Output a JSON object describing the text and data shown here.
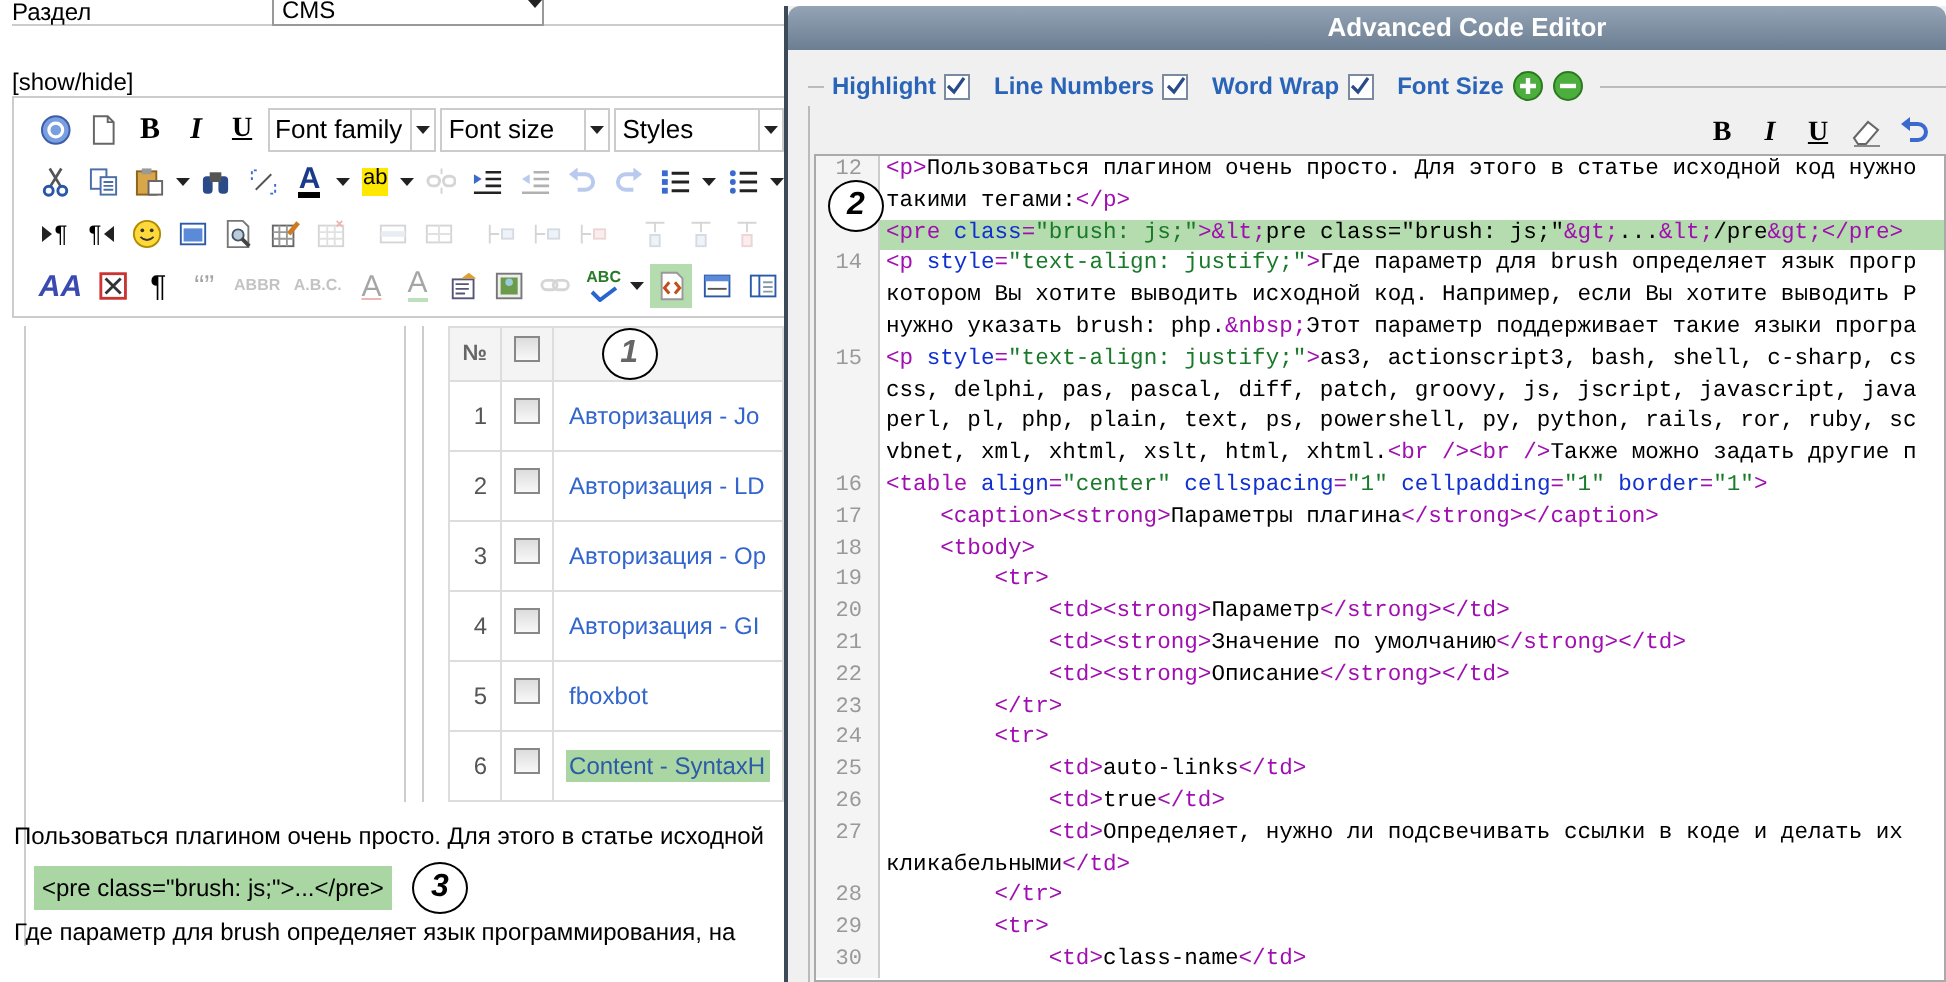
{
  "section_field": {
    "label": "Раздел",
    "value": "CMS"
  },
  "show_hide": "[show/hide]",
  "toolbar_rows": [
    [
      {
        "kind": "help",
        "disabled": false
      },
      {
        "kind": "document",
        "disabled": false
      },
      {
        "kind": "bold",
        "text": "B",
        "disabled": false
      },
      {
        "kind": "italic",
        "text": "I",
        "disabled": false
      },
      {
        "kind": "underline",
        "text": "U",
        "disabled": false
      },
      {
        "kind": "select",
        "text": "Font family"
      },
      {
        "kind": "select",
        "text": "Font size"
      },
      {
        "kind": "select",
        "text": "Styles"
      }
    ],
    [
      {
        "kind": "cut",
        "disabled": false
      },
      {
        "kind": "copy",
        "disabled": false
      },
      {
        "kind": "paste",
        "disabled": false,
        "dropdown": true
      },
      {
        "kind": "find",
        "disabled": false
      },
      {
        "kind": "replace",
        "disabled": false
      },
      {
        "kind": "forecolor",
        "text": "A",
        "disabled": false,
        "dropdown": true
      },
      {
        "kind": "backcolor",
        "text": "ab",
        "disabled": false,
        "dropdown": true
      },
      {
        "kind": "unlink",
        "disabled": true
      },
      {
        "kind": "indent",
        "disabled": false
      },
      {
        "kind": "outdent",
        "disabled": true
      },
      {
        "kind": "undo",
        "disabled": true
      },
      {
        "kind": "redo",
        "disabled": true
      },
      {
        "kind": "numlist",
        "disabled": false,
        "dropdown": true
      },
      {
        "kind": "bullist",
        "disabled": false,
        "dropdown": true
      }
    ],
    [
      {
        "kind": "ltr",
        "text": "¶",
        "disabled": false
      },
      {
        "kind": "rtl",
        "text": "¶",
        "disabled": false
      },
      {
        "kind": "smiley",
        "disabled": false
      },
      {
        "kind": "window",
        "disabled": false
      },
      {
        "kind": "preview",
        "disabled": false
      },
      {
        "kind": "table-edit",
        "disabled": false
      },
      {
        "kind": "table-delete",
        "disabled": true
      },
      {
        "kind": "sep"
      },
      {
        "kind": "table-row",
        "disabled": true
      },
      {
        "kind": "table-cell",
        "disabled": true
      },
      {
        "kind": "sep"
      },
      {
        "kind": "row-insert",
        "disabled": true
      },
      {
        "kind": "row-insert",
        "disabled": true
      },
      {
        "kind": "row-delete",
        "disabled": true
      },
      {
        "kind": "sep"
      },
      {
        "kind": "col-insert",
        "disabled": true
      },
      {
        "kind": "col-insert",
        "disabled": true
      },
      {
        "kind": "col-delete",
        "disabled": true
      },
      {
        "kind": "sep"
      }
    ],
    [
      {
        "kind": "styleprops",
        "text": "AA",
        "disabled": false
      },
      {
        "kind": "cross-box",
        "disabled": false
      },
      {
        "kind": "pilcrow",
        "text": "¶",
        "disabled": false
      },
      {
        "kind": "cite",
        "text": "“”",
        "disabled": true
      },
      {
        "kind": "abbr",
        "text": "ABBR",
        "disabled": true
      },
      {
        "kind": "acronym",
        "text": "A.B.C.",
        "disabled": true
      },
      {
        "kind": "strike",
        "text": "A",
        "disabled": true
      },
      {
        "kind": "attribs",
        "text": "A",
        "disabled": true
      },
      {
        "kind": "template",
        "disabled": false
      },
      {
        "kind": "picture",
        "disabled": false
      },
      {
        "kind": "link",
        "disabled": true
      },
      {
        "kind": "spell",
        "text": "ABC",
        "disabled": false,
        "dropdown": true
      },
      {
        "kind": "code",
        "disabled": false,
        "selected": true
      },
      {
        "kind": "hr",
        "disabled": false
      },
      {
        "kind": "columns",
        "disabled": false
      }
    ]
  ],
  "table": {
    "number_heading": "№",
    "header_checked": false,
    "callout": "1",
    "rows": [
      {
        "number": "1",
        "checked": false,
        "title": "Авторизация - Jo",
        "selected": false
      },
      {
        "number": "2",
        "checked": false,
        "title": "Авторизация - LD",
        "selected": false
      },
      {
        "number": "3",
        "checked": false,
        "title": "Авторизация - Op",
        "selected": false
      },
      {
        "number": "4",
        "checked": false,
        "title": "Авторизация - GI",
        "selected": false
      },
      {
        "number": "5",
        "checked": false,
        "title": "fboxbot",
        "selected": false
      },
      {
        "number": "6",
        "checked": false,
        "title": "Content - SyntaxH",
        "selected": true
      }
    ]
  },
  "content": {
    "paragraph": "Пользоваться плагином очень просто. Для этого в статье исходной",
    "snippet": "<pre class=\"brush: js;\">...</pre>",
    "callout": "3",
    "paragraph_2": "Где параметр для brush определяет язык программирования, на"
  },
  "editor": {
    "title": "Advanced Code Editor",
    "options": [
      {
        "label": "Highlight",
        "checked": true
      },
      {
        "label": "Line Numbers",
        "checked": true
      },
      {
        "label": "Word Wrap",
        "checked": true
      }
    ],
    "font_size": "Font Size",
    "format_buttons": [
      {
        "kind": "bold",
        "text": "B"
      },
      {
        "kind": "italic",
        "text": "I"
      },
      {
        "kind": "underline",
        "text": "U"
      },
      {
        "kind": "eraser"
      },
      {
        "kind": "undo"
      }
    ],
    "callout": "2",
    "lines": [
      {
        "number": "12",
        "selected": false,
        "tokens": [
          {
            "kind": "tag",
            "text": "<p>"
          },
          {
            "kind": "text",
            "text": "Пользоваться плагином очень просто. Для этого в статье исходной код нужно"
          }
        ]
      },
      {
        "selected": false,
        "tokens": [
          {
            "kind": "text",
            "text": "такими тегами:"
          },
          {
            "kind": "tag",
            "text": "</p>"
          }
        ]
      },
      {
        "selected": true,
        "tokens": [
          {
            "kind": "tag",
            "text": "<pre "
          },
          {
            "kind": "attr",
            "text": "class"
          },
          {
            "kind": "tag",
            "text": "="
          },
          {
            "kind": "value",
            "text": "\"brush: js;\""
          },
          {
            "kind": "tag",
            "text": ">"
          },
          {
            "kind": "entity",
            "text": "&lt;"
          },
          {
            "kind": "text",
            "text": "pre class=\"brush: js;\""
          },
          {
            "kind": "entity",
            "text": "&gt;"
          },
          {
            "kind": "text",
            "text": "..."
          },
          {
            "kind": "entity",
            "text": "&lt;"
          },
          {
            "kind": "text",
            "text": "/pre"
          },
          {
            "kind": "entity",
            "text": "&gt;"
          },
          {
            "kind": "tag",
            "text": "</pre>"
          }
        ]
      },
      {
        "number": "14",
        "selected": false,
        "tokens": [
          {
            "kind": "tag",
            "text": "<p "
          },
          {
            "kind": "attr",
            "text": "style"
          },
          {
            "kind": "tag",
            "text": "="
          },
          {
            "kind": "value",
            "text": "\"text-align: justify;\""
          },
          {
            "kind": "tag",
            "text": ">"
          },
          {
            "kind": "text",
            "text": "Где параметр для brush определяет язык прогр"
          }
        ]
      },
      {
        "selected": false,
        "tokens": [
          {
            "kind": "text",
            "text": "котором Вы хотите выводить исходной код. Например, если Вы хотите выводить P"
          }
        ]
      },
      {
        "selected": false,
        "tokens": [
          {
            "kind": "text",
            "text": "нужно указать brush: php."
          },
          {
            "kind": "entity",
            "text": "&nbsp;"
          },
          {
            "kind": "text",
            "text": "Этот параметр поддерживает такие языки програ"
          }
        ]
      },
      {
        "number": "15",
        "selected": false,
        "tokens": [
          {
            "kind": "tag",
            "text": "<p "
          },
          {
            "kind": "attr",
            "text": "style"
          },
          {
            "kind": "tag",
            "text": "="
          },
          {
            "kind": "value",
            "text": "\"text-align: justify;\""
          },
          {
            "kind": "tag",
            "text": ">"
          },
          {
            "kind": "text",
            "text": "as3, actionscript3, bash, shell, c-sharp, cs"
          }
        ]
      },
      {
        "selected": false,
        "tokens": [
          {
            "kind": "text",
            "text": "css, delphi, pas, pascal, diff, patch, groovy, js, jscript, javascript, java"
          }
        ]
      },
      {
        "selected": false,
        "tokens": [
          {
            "kind": "text",
            "text": "perl, pl, php, plain, text, ps, powershell, py, python, rails, ror, ruby, sc"
          }
        ]
      },
      {
        "selected": false,
        "tokens": [
          {
            "kind": "text",
            "text": "vbnet, xml, xhtml, xslt, html, xhtml."
          },
          {
            "kind": "tag",
            "text": "<br />"
          },
          {
            "kind": "tag",
            "text": "<br />"
          },
          {
            "kind": "text",
            "text": "Также можно задать другие п"
          }
        ]
      },
      {
        "number": "16",
        "selected": false,
        "tokens": [
          {
            "kind": "tag",
            "text": "<table "
          },
          {
            "kind": "attr",
            "text": "align"
          },
          {
            "kind": "tag",
            "text": "="
          },
          {
            "kind": "value",
            "text": "\"center\" "
          },
          {
            "kind": "attr",
            "text": "cellspacing"
          },
          {
            "kind": "tag",
            "text": "="
          },
          {
            "kind": "value",
            "text": "\"1\" "
          },
          {
            "kind": "attr",
            "text": "cellpadding"
          },
          {
            "kind": "tag",
            "text": "="
          },
          {
            "kind": "value",
            "text": "\"1\" "
          },
          {
            "kind": "attr",
            "text": "border"
          },
          {
            "kind": "tag",
            "text": "="
          },
          {
            "kind": "value",
            "text": "\"1\""
          },
          {
            "kind": "tag",
            "text": ">"
          }
        ]
      },
      {
        "number": "17",
        "selected": false,
        "tokens": [
          {
            "kind": "tag",
            "text": "    <caption><strong>"
          },
          {
            "kind": "text",
            "text": "Параметры плагина"
          },
          {
            "kind": "tag",
            "text": "</strong></caption>"
          }
        ]
      },
      {
        "number": "18",
        "selected": false,
        "tokens": [
          {
            "kind": "tag",
            "text": "    <tbody>"
          }
        ]
      },
      {
        "number": "19",
        "selected": false,
        "tokens": [
          {
            "kind": "tag",
            "text": "        <tr>"
          }
        ]
      },
      {
        "number": "20",
        "selected": false,
        "tokens": [
          {
            "kind": "tag",
            "text": "            <td><strong>"
          },
          {
            "kind": "text",
            "text": "Параметр"
          },
          {
            "kind": "tag",
            "text": "</strong></td>"
          }
        ]
      },
      {
        "number": "21",
        "selected": false,
        "tokens": [
          {
            "kind": "tag",
            "text": "            <td><strong>"
          },
          {
            "kind": "text",
            "text": "Значение по умолчанию"
          },
          {
            "kind": "tag",
            "text": "</strong></td>"
          }
        ]
      },
      {
        "number": "22",
        "selected": false,
        "tokens": [
          {
            "kind": "tag",
            "text": "            <td><strong>"
          },
          {
            "kind": "text",
            "text": "Описание"
          },
          {
            "kind": "tag",
            "text": "</strong></td>"
          }
        ]
      },
      {
        "number": "23",
        "selected": false,
        "tokens": [
          {
            "kind": "tag",
            "text": "        </tr>"
          }
        ]
      },
      {
        "number": "24",
        "selected": false,
        "tokens": [
          {
            "kind": "tag",
            "text": "        <tr>"
          }
        ]
      },
      {
        "number": "25",
        "selected": false,
        "tokens": [
          {
            "kind": "tag",
            "text": "            <td>"
          },
          {
            "kind": "text",
            "text": "auto-links"
          },
          {
            "kind": "tag",
            "text": "</td>"
          }
        ]
      },
      {
        "number": "26",
        "selected": false,
        "tokens": [
          {
            "kind": "tag",
            "text": "            <td>"
          },
          {
            "kind": "text",
            "text": "true"
          },
          {
            "kind": "tag",
            "text": "</td>"
          }
        ]
      },
      {
        "number": "27",
        "selected": false,
        "tokens": [
          {
            "kind": "tag",
            "text": "            <td>"
          },
          {
            "kind": "text",
            "text": "Определяет, нужно ли подсвечивать ссылки в коде и делать их"
          }
        ]
      },
      {
        "selected": false,
        "tokens": [
          {
            "kind": "text",
            "text": "кликабельными"
          },
          {
            "kind": "tag",
            "text": "</td>"
          }
        ]
      },
      {
        "number": "28",
        "selected": false,
        "tokens": [
          {
            "kind": "tag",
            "text": "        </tr>"
          }
        ]
      },
      {
        "number": "29",
        "selected": false,
        "tokens": [
          {
            "kind": "tag",
            "text": "        <tr>"
          }
        ]
      },
      {
        "number": "30",
        "selected": false,
        "tokens": [
          {
            "kind": "tag",
            "text": "            <td>"
          },
          {
            "kind": "text",
            "text": "class-name"
          },
          {
            "kind": "tag",
            "text": "</td>"
          }
        ]
      }
    ]
  }
}
